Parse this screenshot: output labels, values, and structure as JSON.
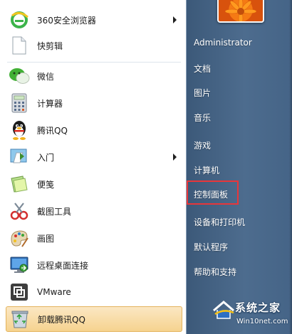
{
  "left_pane": {
    "items": [
      {
        "label": "360安全浏览器",
        "icon": "browser-360-icon",
        "has_submenu": true
      },
      {
        "label": "快剪辑",
        "icon": "document-icon",
        "has_submenu": false
      },
      {
        "label": "微信",
        "icon": "wechat-icon",
        "has_submenu": false
      },
      {
        "label": "计算器",
        "icon": "calculator-icon",
        "has_submenu": false
      },
      {
        "label": "腾讯QQ",
        "icon": "qq-penguin-icon",
        "has_submenu": false
      },
      {
        "label": "入门",
        "icon": "getting-started-icon",
        "has_submenu": true
      },
      {
        "label": "便笺",
        "icon": "sticky-notes-icon",
        "has_submenu": false
      },
      {
        "label": "截图工具",
        "icon": "snipping-tool-icon",
        "has_submenu": false
      },
      {
        "label": "画图",
        "icon": "paint-palette-icon",
        "has_submenu": false
      },
      {
        "label": "远程桌面连接",
        "icon": "remote-desktop-icon",
        "has_submenu": false
      },
      {
        "label": "VMware",
        "icon": "vmware-icon",
        "has_submenu": false
      },
      {
        "label": "卸载腾讯QQ",
        "icon": "recycle-bin-icon",
        "has_submenu": false,
        "highlighted": true
      }
    ]
  },
  "right_pane": {
    "user_name": "Administrator",
    "items": [
      {
        "label": "文档"
      },
      {
        "label": "图片"
      },
      {
        "label": "音乐"
      },
      {
        "label": "游戏"
      },
      {
        "label": "计算机"
      },
      {
        "label": "控制面板",
        "annotated": true
      },
      {
        "label": "设备和打印机"
      },
      {
        "label": "默认程序"
      },
      {
        "label": "帮助和支持"
      }
    ]
  },
  "watermark": {
    "title": "系统之家",
    "url": "Win10net.com"
  },
  "colors": {
    "annotation_red": "#e8363a",
    "right_pane_blue": "#4d6c8e",
    "highlight_orange": "#f6d38f"
  }
}
